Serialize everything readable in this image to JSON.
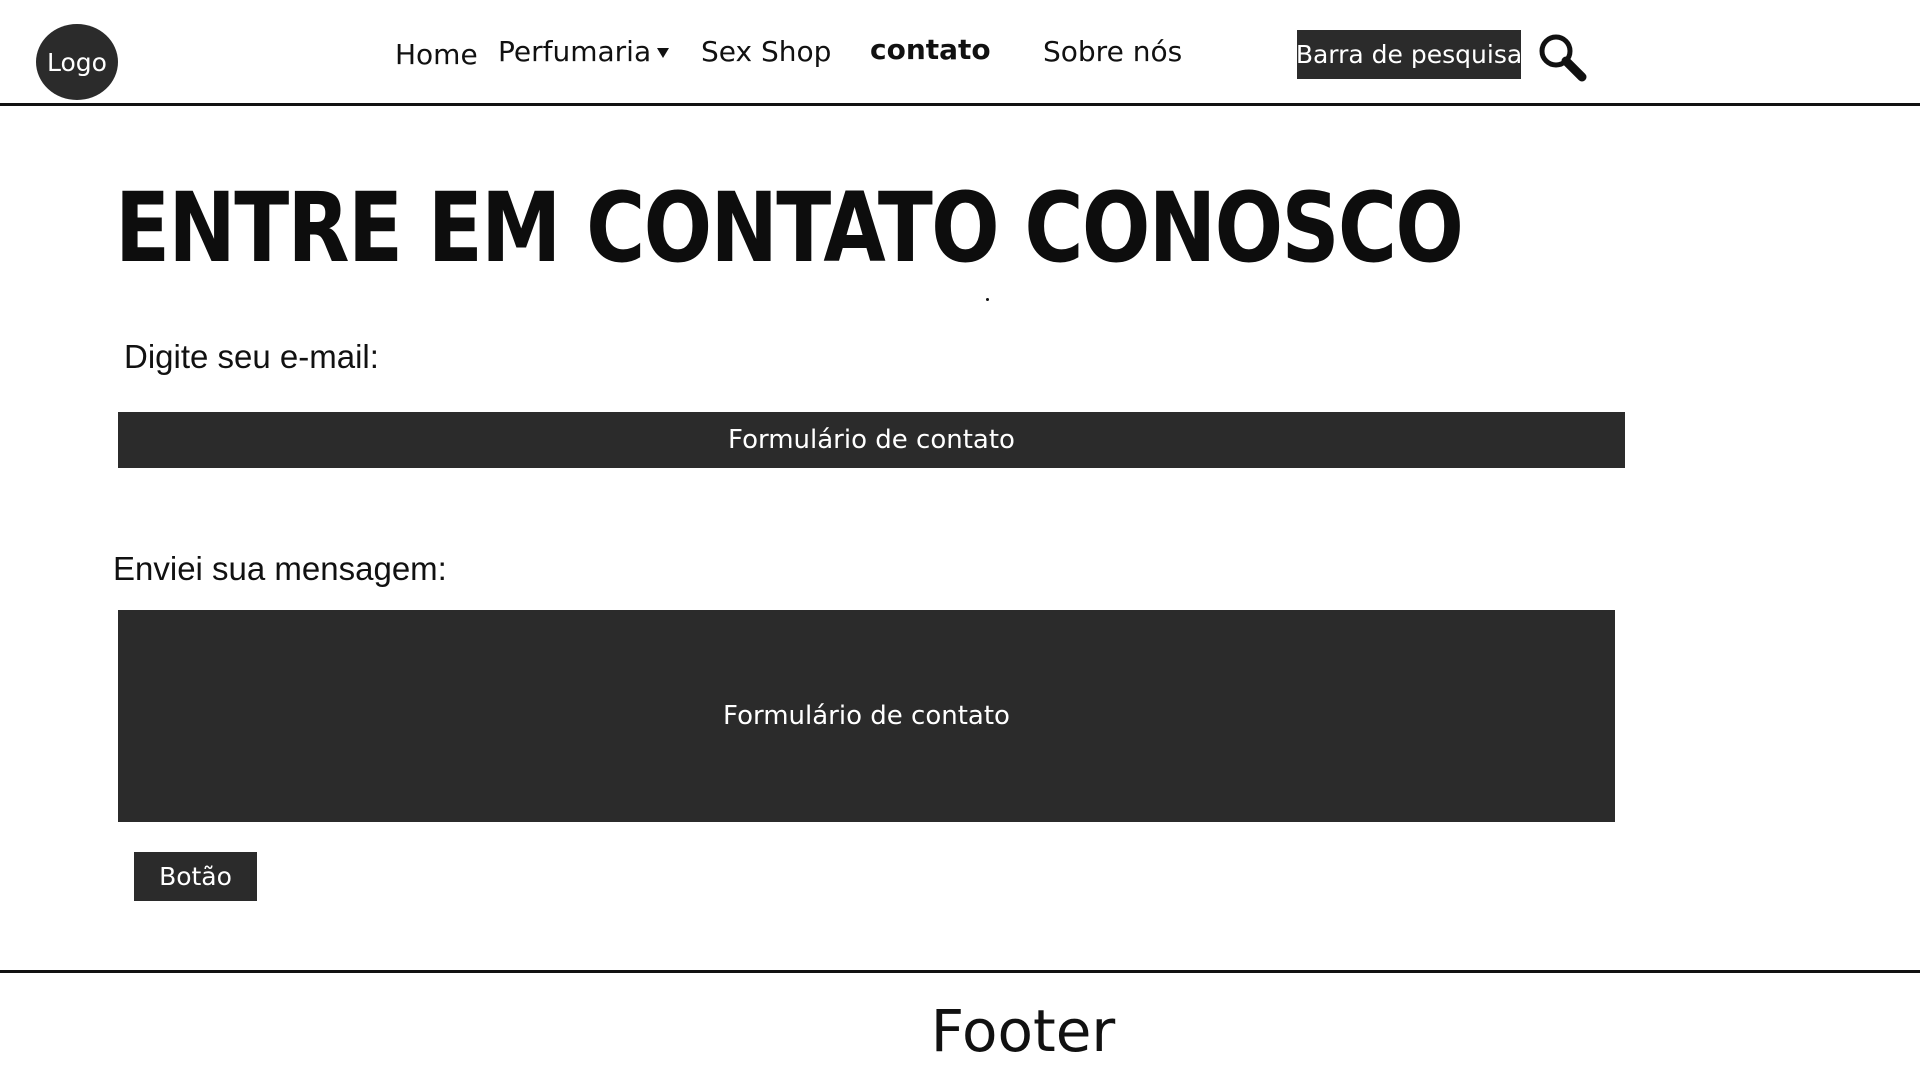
{
  "header": {
    "logo_label": "Logo",
    "nav": {
      "home": "Home",
      "perfumaria": "Perfumaria",
      "sex_shop": "Sex Shop",
      "contato": "contato",
      "sobre": "Sobre nós"
    },
    "active_item": "contato",
    "search_bar_label": "Barra de pesquisa",
    "search_icon": "magnifier-icon"
  },
  "main": {
    "title": "ENTRE EM CONTATO CONOSCO",
    "email_label": "Digite seu e-mail:",
    "email_field_text": "Formulário de contato",
    "message_label": "Enviei sua mensagem:",
    "message_field_text": "Formulário de contato",
    "button_label": "Botão"
  },
  "footer": {
    "text": "Footer"
  },
  "colors": {
    "dark_fill": "#2b2b2b",
    "background": "#ffffff",
    "text": "#111111"
  }
}
